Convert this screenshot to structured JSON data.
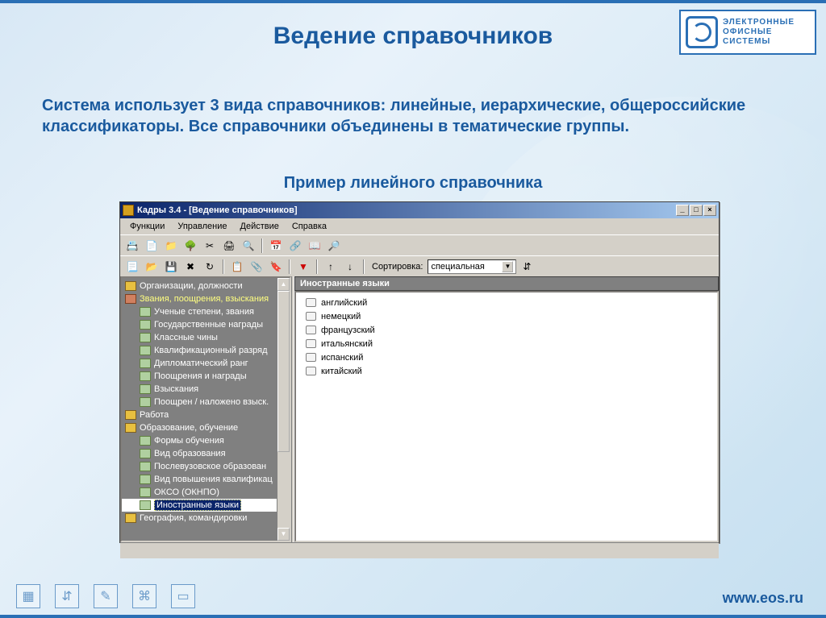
{
  "slide": {
    "title": "Ведение справочников",
    "body": "Система использует 3 вида справочников: линейные, иерархические, общероссийские классификаторы. Все справочники объединены в тематические группы.",
    "subtitle": "Пример линейного справочника"
  },
  "logo": {
    "line1": "ЭЛЕКТРОННЫЕ",
    "line2": "ОФИСНЫЕ",
    "line3": "СИСТЕМЫ"
  },
  "footer": {
    "url": "www.eos.ru"
  },
  "window": {
    "title": "Кадры 3.4 - [Ведение справочников]",
    "menus": [
      "Функции",
      "Управление",
      "Действие",
      "Справка"
    ],
    "sort_label": "Сортировка:",
    "sort_value": "специальная"
  },
  "tree": {
    "items": [
      {
        "label": "Организации, должности",
        "type": "folder",
        "level": 0
      },
      {
        "label": "Звания, поощрения, взыскания",
        "type": "special",
        "level": 0,
        "yellow": true
      },
      {
        "label": "Ученые степени, звания",
        "type": "doc",
        "level": 1
      },
      {
        "label": "Государственные награды",
        "type": "doc",
        "level": 1
      },
      {
        "label": "Классные чины",
        "type": "doc",
        "level": 1
      },
      {
        "label": "Квалификационный разряд",
        "type": "doc",
        "level": 1
      },
      {
        "label": "Дипломатический ранг",
        "type": "doc",
        "level": 1
      },
      {
        "label": "Поощрения и награды",
        "type": "doc",
        "level": 1
      },
      {
        "label": "Взыскания",
        "type": "doc",
        "level": 1
      },
      {
        "label": "Поощрен / наложено взыск.",
        "type": "doc",
        "level": 1
      },
      {
        "label": "Работа",
        "type": "folder",
        "level": 0
      },
      {
        "label": "Образование, обучение",
        "type": "folder",
        "level": 0
      },
      {
        "label": "Формы обучения",
        "type": "doc",
        "level": 1
      },
      {
        "label": "Вид образования",
        "type": "doc",
        "level": 1
      },
      {
        "label": "Послевузовское образован",
        "type": "doc",
        "level": 1
      },
      {
        "label": "Вид повышения квалификац",
        "type": "doc",
        "level": 1
      },
      {
        "label": "ОКСО (ОКНПО)",
        "type": "doc",
        "level": 1
      },
      {
        "label": "Иностранные языки",
        "type": "doc",
        "level": 1,
        "selected": true
      },
      {
        "label": "География, командировки",
        "type": "folder",
        "level": 0
      }
    ]
  },
  "content": {
    "header": "Иностранные языки",
    "rows": [
      "английский",
      "немецкий",
      "французский",
      "итальянский",
      "испанский",
      "китайский"
    ]
  }
}
